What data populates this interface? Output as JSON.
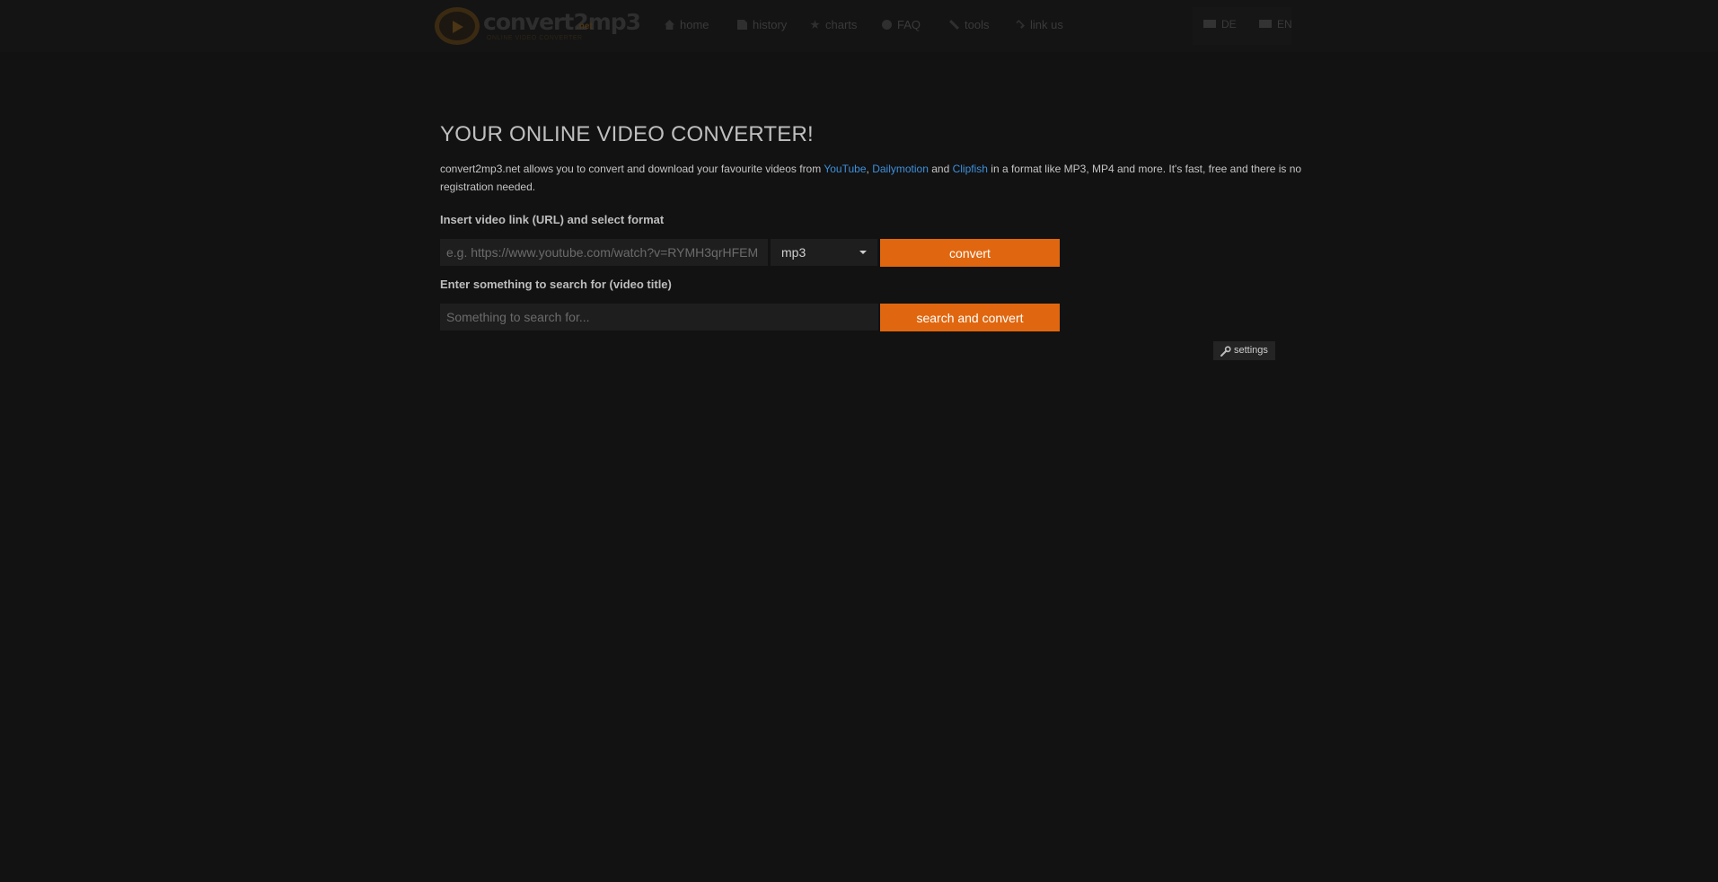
{
  "nav": {
    "logo_text": "convert2mp3",
    "logo_tld": ".net",
    "logo_tagline": "ONLINE VIDEO CONVERTER",
    "links": [
      {
        "label": "home",
        "icon": "home-icon"
      },
      {
        "label": "history",
        "icon": "document-icon"
      },
      {
        "label": "charts",
        "icon": "star-icon"
      },
      {
        "label": "FAQ",
        "icon": "question-icon"
      },
      {
        "label": "tools",
        "icon": "tools-icon"
      },
      {
        "label": "link us",
        "icon": "link-icon"
      }
    ],
    "languages": [
      {
        "label": "DE",
        "icon": "flag-icon"
      },
      {
        "label": "EN",
        "icon": "flag-icon"
      }
    ]
  },
  "main": {
    "title": "YOUR ONLINE VIDEO CONVERTER!",
    "intro": {
      "before": "convert2mp3.net allows you to convert and download your favourite videos from ",
      "link1": "YouTube",
      "sep1": ", ",
      "link2": "Dailymotion",
      "sep2": " and ",
      "link3": "Clipfish",
      "after": " in a format like MP3, MP4 and more. It's fast, free and there is no registration needed."
    },
    "url_label": "Insert video link (URL) and select format",
    "url_placeholder": "e.g. https://www.youtube.com/watch?v=RYMH3qrHFEM",
    "url_value": "",
    "format_selected": "mp3",
    "convert_label": "convert",
    "search_label": "Enter something to search for (video title)",
    "search_placeholder": "Something to search for...",
    "search_value": "",
    "search_button_label": "search and convert",
    "settings_label": "settings"
  },
  "colors": {
    "background": "#121212",
    "accent": "#e0670f",
    "link": "#3d8fdb",
    "input_bg": "#1e1e1e"
  }
}
